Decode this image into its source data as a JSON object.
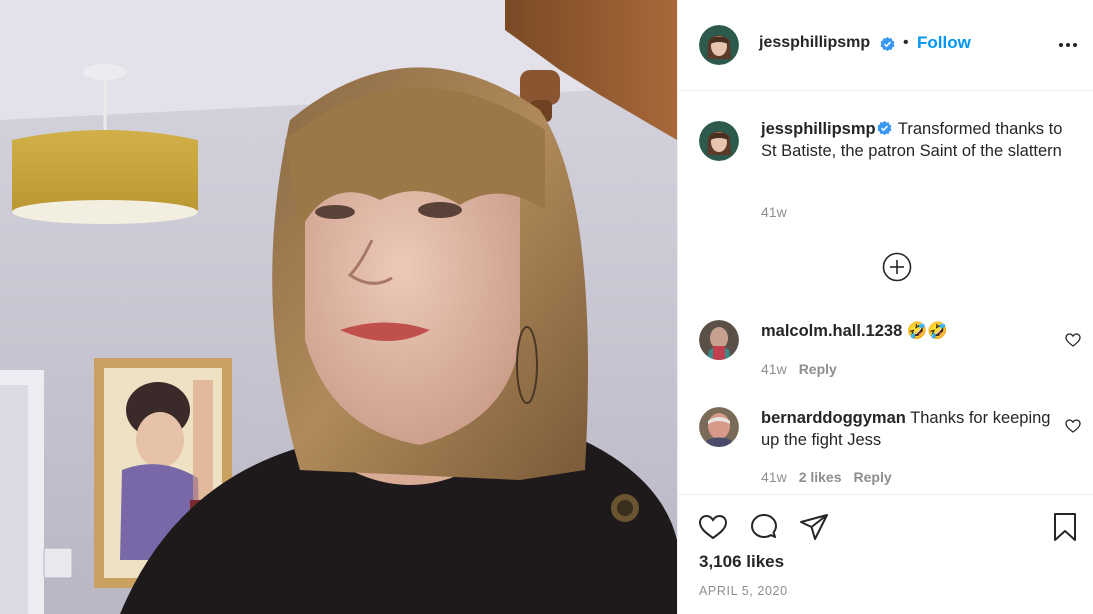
{
  "header": {
    "username": "jessphillipsmp",
    "separator": "•",
    "follow_label": "Follow",
    "icons": [
      "verified-badge-icon",
      "more-options-icon"
    ]
  },
  "caption": {
    "username": "jessphillipsmp",
    "text": "Transformed thanks to St Batiste, the patron Saint of the slattern",
    "time": "41w"
  },
  "load_more_icon": "plus-circle-icon",
  "comments": [
    {
      "username": "malcolm.hall.1238",
      "text": "🤣🤣",
      "time": "41w",
      "likes": "",
      "reply_label": "Reply"
    },
    {
      "username": "bernarddoggyman",
      "text": "Thanks for keeping up the fight Jess",
      "time": "41w",
      "likes": "2 likes",
      "reply_label": "Reply"
    }
  ],
  "actions": {
    "icons": [
      "heart-icon",
      "comment-icon",
      "share-icon",
      "bookmark-icon"
    ]
  },
  "likes_count": "3,106 likes",
  "post_date": "APRIL 5, 2020",
  "colors": {
    "accent": "#0095f6",
    "verified": "#3897f0",
    "text": "#262626",
    "muted": "#8e8e8e",
    "border": "#efefef"
  }
}
